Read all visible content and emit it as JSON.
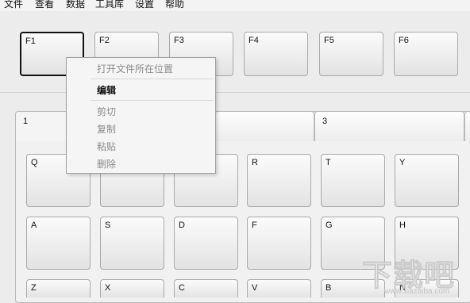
{
  "menubar": {
    "items": [
      {
        "label": "文件"
      },
      {
        "label": "查看"
      },
      {
        "label": "数据"
      },
      {
        "label": "工具库"
      },
      {
        "label": "设置"
      },
      {
        "label": "帮助"
      }
    ]
  },
  "fkeys": [
    {
      "label": "F1",
      "selected": true
    },
    {
      "label": "F2"
    },
    {
      "label": "F3"
    },
    {
      "label": "F4"
    },
    {
      "label": "F5"
    },
    {
      "label": "F6"
    }
  ],
  "tabs": [
    {
      "label": "1",
      "active": true
    },
    {
      "label": "3"
    }
  ],
  "keys": {
    "row1": [
      "Q",
      "",
      "",
      "R",
      "T",
      "Y"
    ],
    "row2": [
      "A",
      "S",
      "D",
      "F",
      "G",
      "H"
    ],
    "row3": [
      "Z",
      "X",
      "C",
      "V",
      "B",
      "N"
    ]
  },
  "context_menu": {
    "items": [
      {
        "label": "打开文件所在位置",
        "enabled": false
      },
      {
        "label": "编辑",
        "enabled": true
      },
      {
        "label": "剪切",
        "enabled": false
      },
      {
        "label": "复制",
        "enabled": false
      },
      {
        "label": "粘贴",
        "enabled": false
      },
      {
        "label": "删除",
        "enabled": false
      }
    ]
  },
  "watermark": {
    "text": "下载吧",
    "url": "www.xiazaiba.com"
  }
}
